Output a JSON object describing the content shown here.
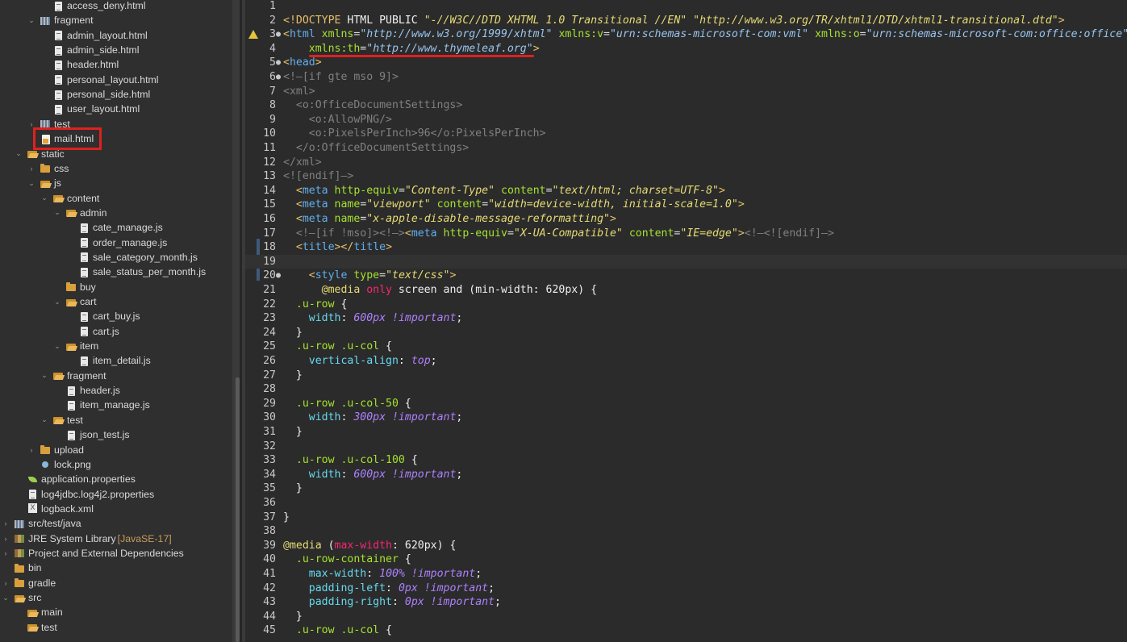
{
  "explorer": {
    "items": [
      {
        "label": "access_deny.html",
        "icon": "file",
        "indent": 66,
        "chev": ""
      },
      {
        "label": "fragment",
        "icon": "package",
        "indent": 50,
        "chev": "⌄"
      },
      {
        "label": "admin_layout.html",
        "icon": "file",
        "indent": 66,
        "chev": ""
      },
      {
        "label": "admin_side.html",
        "icon": "file",
        "indent": 66,
        "chev": ""
      },
      {
        "label": "header.html",
        "icon": "file",
        "indent": 66,
        "chev": ""
      },
      {
        "label": "personal_layout.html",
        "icon": "file",
        "indent": 66,
        "chev": ""
      },
      {
        "label": "personal_side.html",
        "icon": "file",
        "indent": 66,
        "chev": ""
      },
      {
        "label": "user_layout.html",
        "icon": "file",
        "indent": 66,
        "chev": ""
      },
      {
        "label": "test",
        "icon": "package",
        "indent": 50,
        "chev": "›"
      },
      {
        "label": "mail.html",
        "icon": "html",
        "indent": 50,
        "chev": ""
      },
      {
        "label": "static",
        "icon": "folder-open",
        "indent": 34,
        "chev": "⌄"
      },
      {
        "label": "css",
        "icon": "folder",
        "indent": 50,
        "chev": "›"
      },
      {
        "label": "js",
        "icon": "folder-open",
        "indent": 50,
        "chev": "⌄"
      },
      {
        "label": "content",
        "icon": "folder-open",
        "indent": 66,
        "chev": "⌄"
      },
      {
        "label": "admin",
        "icon": "folder-open",
        "indent": 82,
        "chev": "⌄"
      },
      {
        "label": "cate_manage.js",
        "icon": "file",
        "indent": 98,
        "chev": ""
      },
      {
        "label": "order_manage.js",
        "icon": "file",
        "indent": 98,
        "chev": ""
      },
      {
        "label": "sale_category_month.js",
        "icon": "file",
        "indent": 98,
        "chev": ""
      },
      {
        "label": "sale_status_per_month.js",
        "icon": "file",
        "indent": 98,
        "chev": ""
      },
      {
        "label": "buy",
        "icon": "folder",
        "indent": 82,
        "chev": ""
      },
      {
        "label": "cart",
        "icon": "folder-open",
        "indent": 82,
        "chev": "⌄"
      },
      {
        "label": "cart_buy.js",
        "icon": "file",
        "indent": 98,
        "chev": ""
      },
      {
        "label": "cart.js",
        "icon": "file",
        "indent": 98,
        "chev": ""
      },
      {
        "label": "item",
        "icon": "folder-open",
        "indent": 82,
        "chev": "⌄"
      },
      {
        "label": "item_detail.js",
        "icon": "file",
        "indent": 98,
        "chev": ""
      },
      {
        "label": "fragment",
        "icon": "folder-open",
        "indent": 66,
        "chev": "⌄"
      },
      {
        "label": "header.js",
        "icon": "file",
        "indent": 82,
        "chev": ""
      },
      {
        "label": "item_manage.js",
        "icon": "file",
        "indent": 82,
        "chev": ""
      },
      {
        "label": "test",
        "icon": "folder-open",
        "indent": 66,
        "chev": "⌄"
      },
      {
        "label": "json_test.js",
        "icon": "file",
        "indent": 82,
        "chev": ""
      },
      {
        "label": "upload",
        "icon": "folder",
        "indent": 50,
        "chev": "›"
      },
      {
        "label": "lock.png",
        "icon": "png",
        "indent": 50,
        "chev": ""
      },
      {
        "label": "application.properties",
        "icon": "leaf",
        "indent": 34,
        "chev": ""
      },
      {
        "label": "log4jdbc.log4j2.properties",
        "icon": "file",
        "indent": 34,
        "chev": ""
      },
      {
        "label": "logback.xml",
        "icon": "xml",
        "indent": 34,
        "chev": ""
      },
      {
        "label": "src/test/java",
        "icon": "package",
        "indent": 18,
        "chev": "›"
      },
      {
        "label": "JRE System Library",
        "extra": "[JavaSE-17]",
        "icon": "lib",
        "indent": 18,
        "chev": "›"
      },
      {
        "label": "Project and External Dependencies",
        "icon": "lib",
        "indent": 18,
        "chev": "›"
      },
      {
        "label": "bin",
        "icon": "folder",
        "indent": 18,
        "chev": ""
      },
      {
        "label": "gradle",
        "icon": "folder",
        "indent": 18,
        "chev": "›"
      },
      {
        "label": "src",
        "icon": "folder-open",
        "indent": 18,
        "chev": "⌄"
      },
      {
        "label": "main",
        "icon": "folder-open",
        "indent": 34,
        "chev": ""
      },
      {
        "label": "test",
        "icon": "folder-open",
        "indent": 34,
        "chev": ""
      }
    ]
  },
  "editor": {
    "lines": [
      {
        "n": "1",
        "fold": "",
        "tokens": []
      },
      {
        "n": "2",
        "fold": "",
        "tokens": [
          [
            "t-doctype",
            "<!DOCTYPE "
          ],
          [
            "t-white",
            "HTML PUBLIC "
          ],
          [
            "t-str2",
            "\"-//W3C//DTD XHTML 1.0 Transitional //EN\" \"http://www.w3.org/TR/xhtml1/DTD/xhtml1-transitional.dtd\""
          ],
          [
            "t-doctype",
            ">"
          ]
        ]
      },
      {
        "n": "3",
        "fold": "●",
        "warn": true,
        "tokens": [
          [
            "t-tag",
            "<"
          ],
          [
            "t-tagname",
            "html "
          ],
          [
            "t-attr",
            "xmlns"
          ],
          [
            "t-plain",
            "="
          ],
          [
            "t-str",
            "\"http://www.w3.org/1999/xhtml\""
          ],
          [
            "t-plain",
            " "
          ],
          [
            "t-attr",
            "xmlns:v"
          ],
          [
            "t-plain",
            "="
          ],
          [
            "t-str",
            "\"urn:schemas-microsoft-com:vml\""
          ],
          [
            "t-plain",
            " "
          ],
          [
            "t-attr",
            "xmlns:o"
          ],
          [
            "t-plain",
            "="
          ],
          [
            "t-str",
            "\"urn:schemas-microsoft-com:office:office\""
          ]
        ]
      },
      {
        "n": "4",
        "fold": "",
        "tokens": [
          [
            "t-plain",
            "    "
          ],
          [
            "t-attr",
            "xmlns:th"
          ],
          [
            "t-plain",
            "="
          ],
          [
            "t-str",
            "\"http://www.thymeleaf.org\""
          ],
          [
            "t-tag",
            ">"
          ]
        ]
      },
      {
        "n": "5",
        "fold": "●",
        "tokens": [
          [
            "t-tag",
            "<"
          ],
          [
            "t-tagname",
            "head"
          ],
          [
            "t-tag",
            ">"
          ]
        ]
      },
      {
        "n": "6",
        "fold": "●",
        "tokens": [
          [
            "t-comment",
            "<!—[if gte mso 9]>"
          ]
        ]
      },
      {
        "n": "7",
        "fold": "",
        "tokens": [
          [
            "t-comment",
            "<xml>"
          ]
        ]
      },
      {
        "n": "8",
        "fold": "",
        "tokens": [
          [
            "t-comment",
            "  <o:OfficeDocumentSettings>"
          ]
        ]
      },
      {
        "n": "9",
        "fold": "",
        "tokens": [
          [
            "t-comment",
            "    <o:AllowPNG/>"
          ]
        ]
      },
      {
        "n": "10",
        "fold": "",
        "tokens": [
          [
            "t-comment",
            "    <o:PixelsPerInch>96</o:PixelsPerInch>"
          ]
        ]
      },
      {
        "n": "11",
        "fold": "",
        "tokens": [
          [
            "t-comment",
            "  </o:OfficeDocumentSettings>"
          ]
        ]
      },
      {
        "n": "12",
        "fold": "",
        "tokens": [
          [
            "t-comment",
            "</xml>"
          ]
        ]
      },
      {
        "n": "13",
        "fold": "",
        "tokens": [
          [
            "t-comment",
            "<![endif]—>"
          ]
        ]
      },
      {
        "n": "14",
        "fold": "",
        "tokens": [
          [
            "t-plain",
            "  "
          ],
          [
            "t-tag",
            "<"
          ],
          [
            "t-tagname",
            "meta "
          ],
          [
            "t-attr",
            "http-equiv"
          ],
          [
            "t-plain",
            "="
          ],
          [
            "t-str2",
            "\"Content-Type\""
          ],
          [
            "t-plain",
            " "
          ],
          [
            "t-attr",
            "content"
          ],
          [
            "t-plain",
            "="
          ],
          [
            "t-str2",
            "\"text/html; charset=UTF-8\""
          ],
          [
            "t-tag",
            ">"
          ]
        ]
      },
      {
        "n": "15",
        "fold": "",
        "tokens": [
          [
            "t-plain",
            "  "
          ],
          [
            "t-tag",
            "<"
          ],
          [
            "t-tagname",
            "meta "
          ],
          [
            "t-attr",
            "name"
          ],
          [
            "t-plain",
            "="
          ],
          [
            "t-str2",
            "\"viewport\""
          ],
          [
            "t-plain",
            " "
          ],
          [
            "t-attr",
            "content"
          ],
          [
            "t-plain",
            "="
          ],
          [
            "t-str2",
            "\"width=device-width, initial-scale=1.0\""
          ],
          [
            "t-tag",
            ">"
          ]
        ]
      },
      {
        "n": "16",
        "fold": "",
        "tokens": [
          [
            "t-plain",
            "  "
          ],
          [
            "t-tag",
            "<"
          ],
          [
            "t-tagname",
            "meta "
          ],
          [
            "t-attr",
            "name"
          ],
          [
            "t-plain",
            "="
          ],
          [
            "t-str2",
            "\"x-apple-disable-message-reformatting\""
          ],
          [
            "t-tag",
            ">"
          ]
        ]
      },
      {
        "n": "17",
        "fold": "",
        "tokens": [
          [
            "t-plain",
            "  "
          ],
          [
            "t-comment",
            "<!—[if !mso]><!—>"
          ],
          [
            "t-tag",
            "<"
          ],
          [
            "t-tagname",
            "meta "
          ],
          [
            "t-attr",
            "http-equiv"
          ],
          [
            "t-plain",
            "="
          ],
          [
            "t-str2",
            "\"X-UA-Compatible\""
          ],
          [
            "t-plain",
            " "
          ],
          [
            "t-attr",
            "content"
          ],
          [
            "t-plain",
            "="
          ],
          [
            "t-str2",
            "\"IE=edge\""
          ],
          [
            "t-tag",
            ">"
          ],
          [
            "t-comment",
            "<!—<![endif]—>"
          ]
        ]
      },
      {
        "n": "18",
        "fold": "",
        "tokens": [
          [
            "t-plain",
            "  "
          ],
          [
            "t-tag",
            "<"
          ],
          [
            "t-tagname",
            "title"
          ],
          [
            "t-tag",
            "></"
          ],
          [
            "t-tagname",
            "title"
          ],
          [
            "t-tag",
            ">"
          ]
        ]
      },
      {
        "n": "19",
        "fold": "",
        "current": true,
        "tokens": []
      },
      {
        "n": "20",
        "fold": "●",
        "tokens": [
          [
            "t-plain",
            "    "
          ],
          [
            "t-tag",
            "<"
          ],
          [
            "t-tagname",
            "style "
          ],
          [
            "t-attr",
            "type"
          ],
          [
            "t-plain",
            "="
          ],
          [
            "t-str2",
            "\"text/css\""
          ],
          [
            "t-tag",
            ">"
          ]
        ]
      },
      {
        "n": "21",
        "fold": "",
        "tokens": [
          [
            "t-plain",
            "      "
          ],
          [
            "t-at",
            "@media "
          ],
          [
            "t-kw",
            "only"
          ],
          [
            "t-white",
            " screen and (min-width: 620px) {"
          ]
        ]
      },
      {
        "n": "22",
        "fold": "",
        "tokens": [
          [
            "t-plain",
            "  "
          ],
          [
            "t-sel",
            ".u-row"
          ],
          [
            "t-white",
            " {"
          ]
        ]
      },
      {
        "n": "23",
        "fold": "",
        "tokens": [
          [
            "t-plain",
            "    "
          ],
          [
            "t-prop",
            "width"
          ],
          [
            "t-white",
            ": "
          ],
          [
            "t-val",
            "600px !important"
          ],
          [
            "t-white",
            ";"
          ]
        ]
      },
      {
        "n": "24",
        "fold": "",
        "tokens": [
          [
            "t-white",
            "  }"
          ]
        ]
      },
      {
        "n": "25",
        "fold": "",
        "tokens": [
          [
            "t-plain",
            "  "
          ],
          [
            "t-sel",
            ".u-row .u-col"
          ],
          [
            "t-white",
            " {"
          ]
        ]
      },
      {
        "n": "26",
        "fold": "",
        "tokens": [
          [
            "t-plain",
            "    "
          ],
          [
            "t-prop",
            "vertical-align"
          ],
          [
            "t-white",
            ": "
          ],
          [
            "t-val",
            "top"
          ],
          [
            "t-white",
            ";"
          ]
        ]
      },
      {
        "n": "27",
        "fold": "",
        "tokens": [
          [
            "t-white",
            "  }"
          ]
        ]
      },
      {
        "n": "28",
        "fold": "",
        "tokens": []
      },
      {
        "n": "29",
        "fold": "",
        "tokens": [
          [
            "t-plain",
            "  "
          ],
          [
            "t-sel",
            ".u-row .u-col-50"
          ],
          [
            "t-white",
            " {"
          ]
        ]
      },
      {
        "n": "30",
        "fold": "",
        "tokens": [
          [
            "t-plain",
            "    "
          ],
          [
            "t-prop",
            "width"
          ],
          [
            "t-white",
            ": "
          ],
          [
            "t-val",
            "300px !important"
          ],
          [
            "t-white",
            ";"
          ]
        ]
      },
      {
        "n": "31",
        "fold": "",
        "tokens": [
          [
            "t-white",
            "  }"
          ]
        ]
      },
      {
        "n": "32",
        "fold": "",
        "tokens": []
      },
      {
        "n": "33",
        "fold": "",
        "tokens": [
          [
            "t-plain",
            "  "
          ],
          [
            "t-sel",
            ".u-row .u-col-100"
          ],
          [
            "t-white",
            " {"
          ]
        ]
      },
      {
        "n": "34",
        "fold": "",
        "tokens": [
          [
            "t-plain",
            "    "
          ],
          [
            "t-prop",
            "width"
          ],
          [
            "t-white",
            ": "
          ],
          [
            "t-val",
            "600px !important"
          ],
          [
            "t-white",
            ";"
          ]
        ]
      },
      {
        "n": "35",
        "fold": "",
        "tokens": [
          [
            "t-white",
            "  }"
          ]
        ]
      },
      {
        "n": "36",
        "fold": "",
        "tokens": []
      },
      {
        "n": "37",
        "fold": "",
        "tokens": [
          [
            "t-white",
            "}"
          ]
        ]
      },
      {
        "n": "38",
        "fold": "",
        "tokens": []
      },
      {
        "n": "39",
        "fold": "",
        "tokens": [
          [
            "t-at",
            "@media "
          ],
          [
            "t-white",
            "("
          ],
          [
            "t-kw",
            "max-width"
          ],
          [
            "t-white",
            ": 620px) {"
          ]
        ]
      },
      {
        "n": "40",
        "fold": "",
        "tokens": [
          [
            "t-plain",
            "  "
          ],
          [
            "t-sel",
            ".u-row-container"
          ],
          [
            "t-white",
            " {"
          ]
        ]
      },
      {
        "n": "41",
        "fold": "",
        "tokens": [
          [
            "t-plain",
            "    "
          ],
          [
            "t-prop",
            "max-width"
          ],
          [
            "t-white",
            ": "
          ],
          [
            "t-val",
            "100% !important"
          ],
          [
            "t-white",
            ";"
          ]
        ]
      },
      {
        "n": "42",
        "fold": "",
        "tokens": [
          [
            "t-plain",
            "    "
          ],
          [
            "t-prop",
            "padding-left"
          ],
          [
            "t-white",
            ": "
          ],
          [
            "t-val",
            "0px !important"
          ],
          [
            "t-white",
            ";"
          ]
        ]
      },
      {
        "n": "43",
        "fold": "",
        "tokens": [
          [
            "t-plain",
            "    "
          ],
          [
            "t-prop",
            "padding-right"
          ],
          [
            "t-white",
            ": "
          ],
          [
            "t-val",
            "0px !important"
          ],
          [
            "t-white",
            ";"
          ]
        ]
      },
      {
        "n": "44",
        "fold": "",
        "tokens": [
          [
            "t-white",
            "  }"
          ]
        ]
      },
      {
        "n": "45",
        "fold": "",
        "tokens": [
          [
            "t-plain",
            "  "
          ],
          [
            "t-sel",
            ".u-row .u-col"
          ],
          [
            "t-white",
            " {"
          ]
        ]
      }
    ]
  }
}
